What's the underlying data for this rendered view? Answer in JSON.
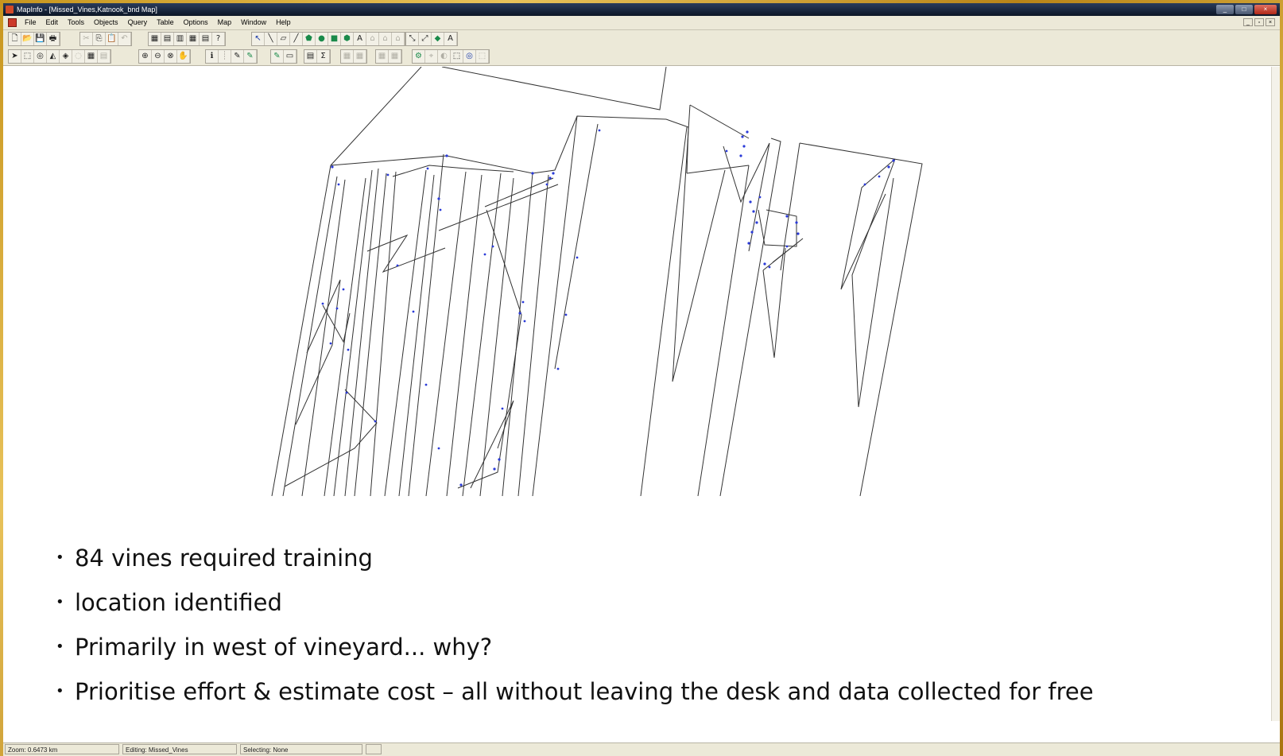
{
  "window": {
    "title": "MapInfo - [Missed_Vines,Katnook_bnd Map]",
    "controls": [
      "_",
      "□",
      "×"
    ]
  },
  "menu": {
    "items": [
      "File",
      "Edit",
      "Tools",
      "Objects",
      "Query",
      "Table",
      "Options",
      "Map",
      "Window",
      "Help"
    ],
    "mdi_controls": [
      "_",
      "▫",
      "×"
    ]
  },
  "toolbar": {
    "row1_groups": [
      [
        "🗋",
        "📂",
        "💾",
        "🖶"
      ],
      [
        "✂",
        "⎘",
        "📋",
        "↶"
      ],
      [
        "▦",
        "▤",
        "▥",
        "▦",
        "▤",
        "?"
      ],
      [
        "↖",
        "╲",
        "▱",
        "╱",
        "⬟",
        "●",
        "■",
        "⬢",
        "A",
        "⌂",
        "⌂",
        "⌂"
      ],
      [
        "⤡",
        "⤢",
        "◆",
        "A"
      ]
    ],
    "row2_groups": [
      [
        "➤",
        "⬚",
        "◎",
        "◭",
        "◈",
        "◌",
        "▦",
        "▤"
      ],
      [
        "⊕",
        "⊖",
        "⊗",
        "✋"
      ],
      [
        "ℹ",
        "┊",
        "✎",
        "✎"
      ],
      [
        "✎",
        "▭"
      ],
      [
        "▤",
        "Σ"
      ],
      [
        "▦",
        "▦"
      ],
      [
        "▦",
        "▦"
      ],
      [
        "⚙",
        "⌖",
        "◐",
        "⬚",
        "◎",
        "⬚"
      ]
    ]
  },
  "slide": {
    "bullets": [
      "84 vines required training",
      "location identified",
      "Primarily in west of vineyard... why?",
      "Prioritise effort & estimate cost – all without leaving the desk and data collected for free"
    ]
  },
  "status": {
    "zoom": "Zoom: 0.6473 km",
    "editing": "Editing: Missed_Vines",
    "selecting": "Selecting: None"
  },
  "colors": {
    "boundary": "#333333",
    "vine_points": "#2a3ad8",
    "chrome": "#ece9d8"
  }
}
